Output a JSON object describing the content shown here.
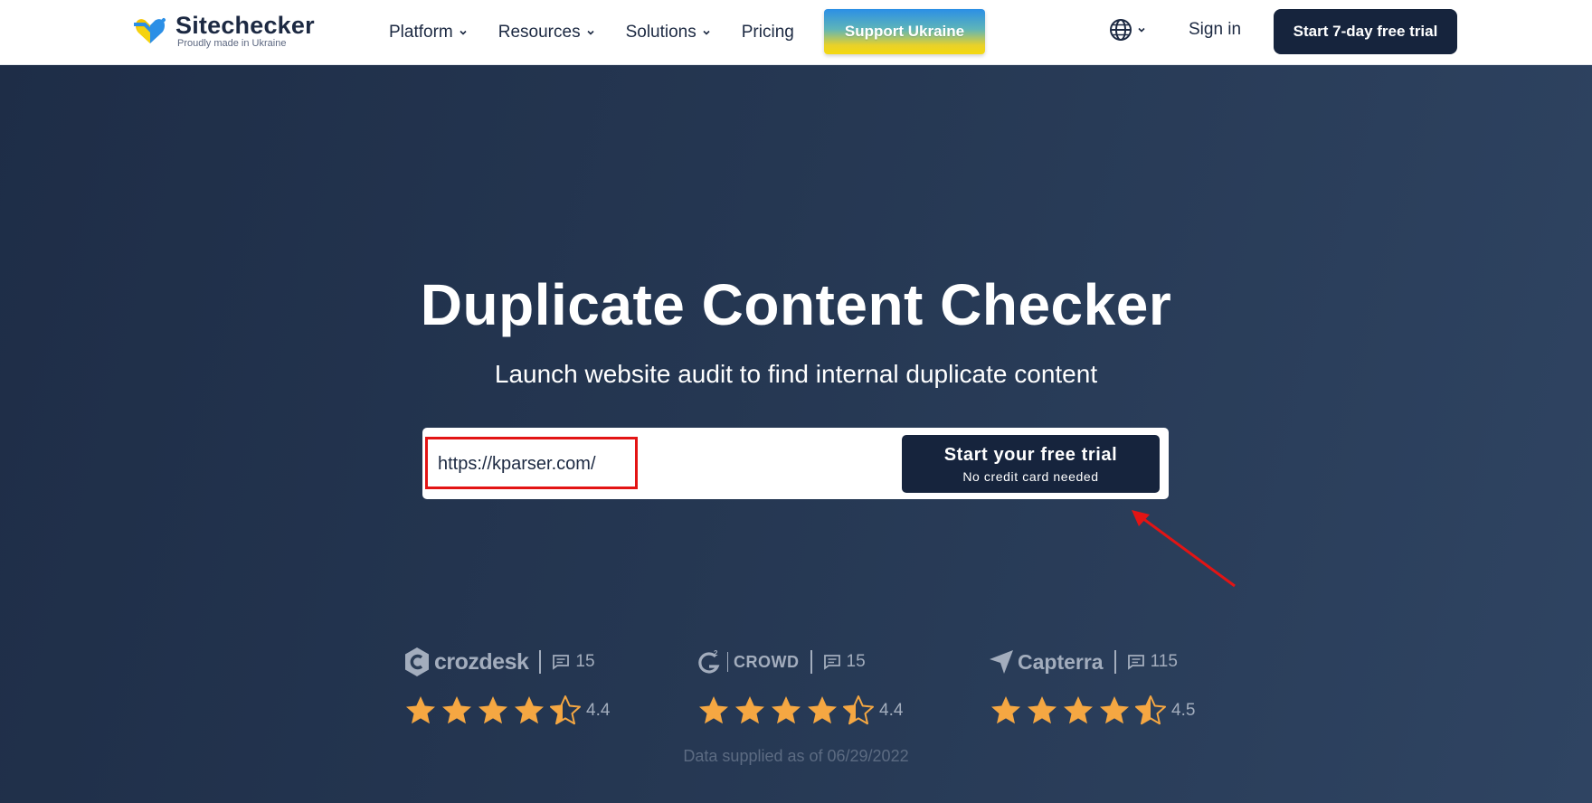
{
  "header": {
    "logo_name": "Sitechecker",
    "logo_tagline": "Proudly made in Ukraine",
    "nav": [
      {
        "label": "Platform"
      },
      {
        "label": "Resources"
      },
      {
        "label": "Solutions"
      },
      {
        "label": "Pricing"
      }
    ],
    "support_label": "Support Ukraine",
    "signin_label": "Sign in",
    "trial_label": "Start 7-day free trial"
  },
  "hero": {
    "title": "Duplicate Content Checker",
    "subtitle": "Launch website audit to find internal duplicate content",
    "url_value": "https://kparser.com/",
    "cta_main": "Start your free trial",
    "cta_sub": "No credit card needed"
  },
  "ratings": [
    {
      "brand": "crozdesk",
      "reviews": "15",
      "score": "4.4",
      "stars": 4.4
    },
    {
      "brand": "CROWD",
      "brand_prefix": "G2",
      "reviews": "15",
      "score": "4.4",
      "stars": 4.4
    },
    {
      "brand": "Capterra",
      "reviews": "115",
      "score": "4.5",
      "stars": 4.5
    }
  ],
  "footnote": "Data supplied as of 06/29/2022",
  "colors": {
    "navy": "#16243d",
    "star": "#f5a742",
    "annotation_red": "#e31414"
  }
}
